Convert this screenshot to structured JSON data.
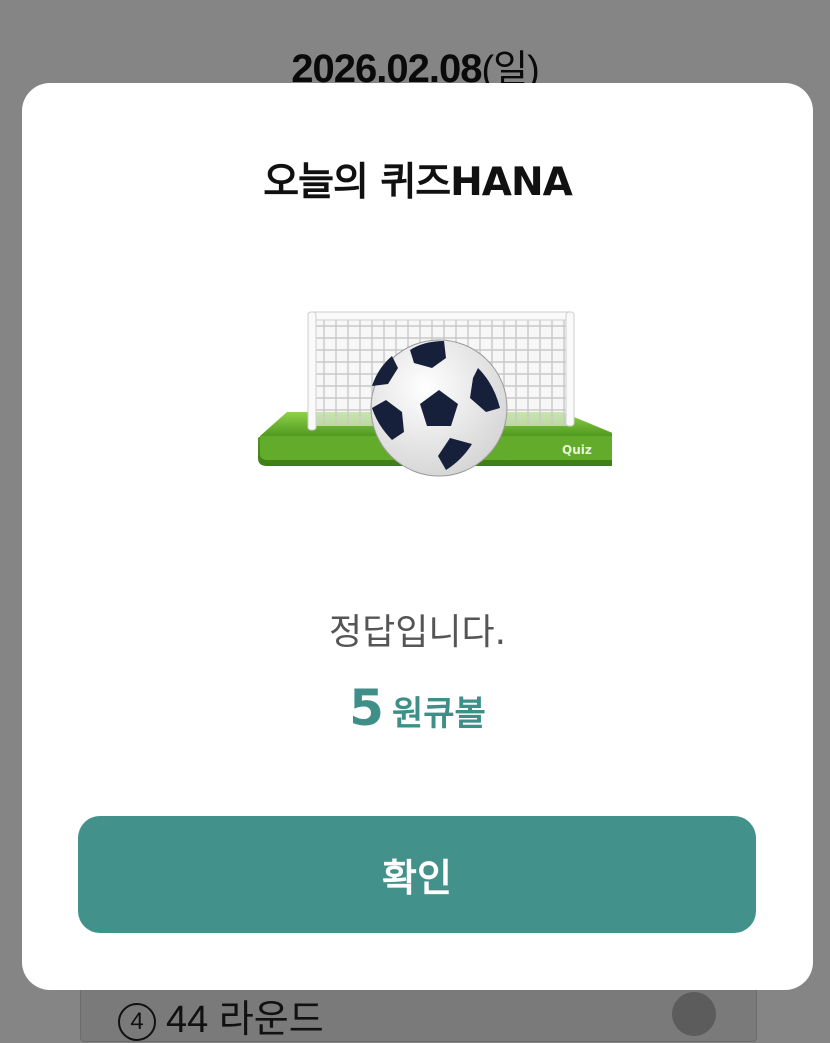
{
  "background": {
    "date": "2026.02.08",
    "day_of_week": "(일)",
    "option_number": "4",
    "option_text": "44 라운드"
  },
  "modal": {
    "title": "오늘의 퀴즈HANA",
    "illustration": {
      "icon": "soccer-goal-icon",
      "badge": "Quiz"
    },
    "result_message": "정답입니다.",
    "reward_amount": "5",
    "reward_unit": "원큐볼",
    "confirm_label": "확인"
  },
  "colors": {
    "accent": "#42918b",
    "reward_text": "#3f8f88",
    "overlay": "#858585",
    "field_green": "#6bb530"
  }
}
